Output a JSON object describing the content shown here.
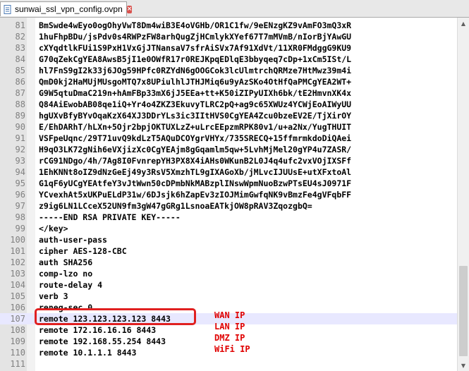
{
  "tab": {
    "label": "sunwai_ssl_vpn_config.ovpn",
    "icon": "file-icon",
    "close_icon": "close-icon",
    "close_glyph": "×"
  },
  "editor": {
    "lines": [
      {
        "n": "81",
        "text": "BmSwde4wEyo0ogOhyVwT8Dm4wiB3E4oVGHb/OR1C1fw/9eENzgKZ9vAmFO3mQ3xR"
      },
      {
        "n": "82",
        "text": "1huFhpBDu/jsPdv0s4RWPzFW8arhQugZjHCmlykXYef67T7mMVmB/nIorBjYAwGU"
      },
      {
        "n": "83",
        "text": "cXYqdtlkFUi1S9PxH1VxGjJTNansaV7sfrAiSVx7Af91XdVt/11XR0FMdggG9KU9"
      },
      {
        "n": "84",
        "text": "G70qZekCgYEA8AwsB5jI1e0OWfR17r0REJKpqEDlqE3bbyqeq7cDp+1xCm5ISt/L"
      },
      {
        "n": "85",
        "text": "hl7FnS9gI2k33j6JOg59HPfc0RZYdN6gOOGCok3lcUlmtrchQRMze7HtMwz39m4i"
      },
      {
        "n": "86",
        "text": "QmD0kj2HaMUjMUsgoMTQ7x8UPiulhlJTHJMiq6u9yAzSKo4OtHfQaPMCgYEA2WT+"
      },
      {
        "n": "87",
        "text": "G9W5qtuDmaC219n+hAmFBp33mX6jJ5EEa+tt+K50iZIPyUIXh6bk/tE2HmvnXK4x"
      },
      {
        "n": "88",
        "text": "Q84AiEwobAB08qe1iQ+Yr4o4ZKZ3EkuvyTLRC2pQ+ag9c65XWUz4YCWjEoAIWyUU"
      },
      {
        "n": "89",
        "text": "hgUXvBfyBYvOqaKzX64XJ3DDrYLs3ic3IItHVS0CgYEA4Zcu0bzeEV2E/TjXirOY"
      },
      {
        "n": "90",
        "text": "E/EhDARhT/hLXn+5Ojr2bpjOKTUXLzZ+uLrcEEpzmRPK80v1/u+a2Nx/YugTHUIT"
      },
      {
        "n": "91",
        "text": "VSFpeUqnc/29T71uvQ9kdLzT5AQuDCOYgrVHYx/735SRECQ+15ffmrmkdoDiQAei"
      },
      {
        "n": "92",
        "text": "H9qO3LK72gNih6eVXjizXc0CgYEAjm8gGqamlm5qw+5LvhMjMel20gYP4u7ZASR/"
      },
      {
        "n": "93",
        "text": "rCG91NDgo/4h/7Ag8I0FvnrepYH3PX8X4iAHs0WKunB2L0J4q4ufc2vxVOjIXSFf"
      },
      {
        "n": "94",
        "text": "1EhKNNt8oIZ9dNzGeEj49y3RsV5XmzhTL9gIXAGoXb/jMLvcIJUUsE+utXFxtoAl"
      },
      {
        "n": "95",
        "text": "G1qF6yUCgYEAtfeY3vJtWwn50cDPmbNkMABzplINswWpmNuoBzwPTsEU4sJ0971F"
      },
      {
        "n": "96",
        "text": "YCvexhAt5xUKPuELdP31w/6DJsjk6hZapEv3zIOJMimGwfqNK9vBmzFe4gVFqbFF"
      },
      {
        "n": "97",
        "text": "z9ig6LN1LCceX52UN9fm3gW47gGRg1LsnoaEATkjOW8pRAV3ZqozgbQ="
      },
      {
        "n": "98",
        "text": "-----END RSA PRIVATE KEY-----"
      },
      {
        "n": "99",
        "text": "</key>"
      },
      {
        "n": "100",
        "text": "auth-user-pass"
      },
      {
        "n": "101",
        "text": "cipher AES-128-CBC"
      },
      {
        "n": "102",
        "text": "auth SHA256"
      },
      {
        "n": "103",
        "text": "comp-lzo no"
      },
      {
        "n": "104",
        "text": "route-delay 4"
      },
      {
        "n": "105",
        "text": "verb 3"
      },
      {
        "n": "106",
        "text": "reneg-sec 0"
      },
      {
        "n": "107",
        "text": "remote 123.123.123.123 8443"
      },
      {
        "n": "108",
        "text": "remote 172.16.16.16 8443"
      },
      {
        "n": "109",
        "text": "remote 192.168.55.254 8443"
      },
      {
        "n": "110",
        "text": "remote 10.1.1.1 8443"
      },
      {
        "n": "111",
        "text": ""
      }
    ],
    "current_line": "107"
  },
  "annotations": [
    {
      "line": "107",
      "label": "WAN IP"
    },
    {
      "line": "108",
      "label": "LAN IP"
    },
    {
      "line": "109",
      "label": "DMZ IP"
    },
    {
      "line": "110",
      "label": "WiFi IP"
    }
  ],
  "colors": {
    "annotation": "#e00000",
    "highlight_box": "#e02020",
    "current_line": "#e8e8ff"
  },
  "scrollbar": {
    "up_glyph": "▲",
    "down_glyph": "▼"
  }
}
